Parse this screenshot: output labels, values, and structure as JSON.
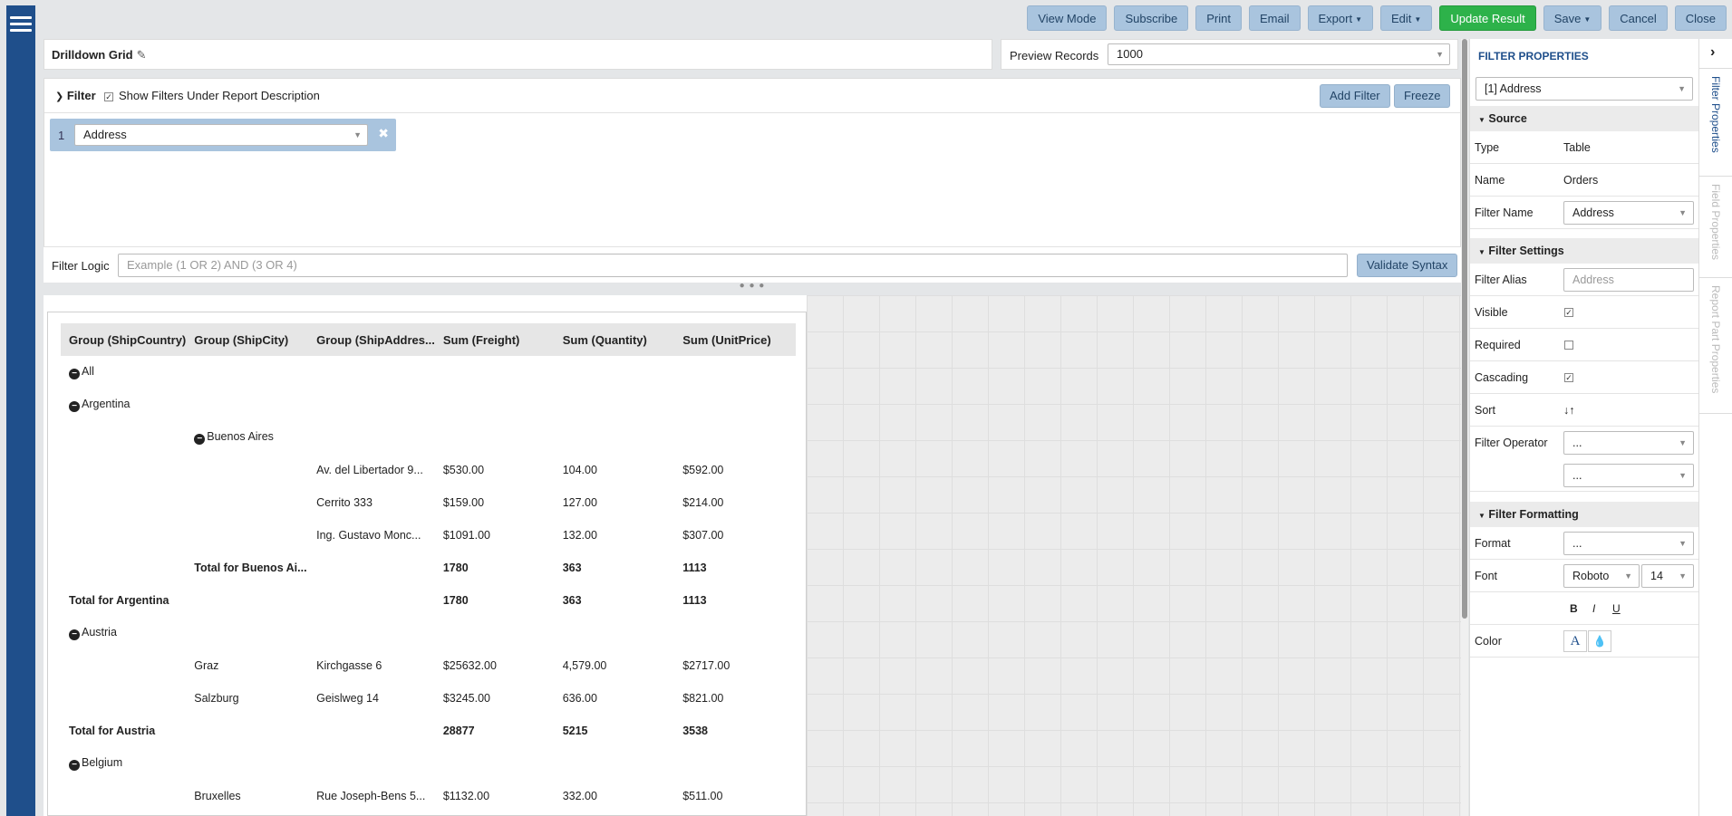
{
  "toolbar": {
    "view_mode": "View Mode",
    "subscribe": "Subscribe",
    "print": "Print",
    "email": "Email",
    "export": "Export",
    "edit": "Edit",
    "update_result": "Update Result",
    "save": "Save",
    "cancel": "Cancel",
    "close": "Close"
  },
  "report": {
    "title": "Drilldown Grid",
    "preview_label": "Preview Records",
    "preview_value": "1000"
  },
  "filter": {
    "title": "Filter",
    "show_under_desc": "Show Filters Under Report Description",
    "add_filter": "Add Filter",
    "freeze": "Freeze",
    "row_number": "1",
    "row_field": "Address",
    "logic_label": "Filter Logic",
    "logic_placeholder": "Example (1 OR 2) AND (3 OR 4)",
    "validate": "Validate Syntax"
  },
  "grid": {
    "headers": [
      "Group (ShipCountry)",
      "Group (ShipCity)",
      "Group (ShipAddres...",
      "Sum (Freight)",
      "Sum (Quantity)",
      "Sum (UnitPrice)"
    ],
    "rows": [
      {
        "c0": "All"
      },
      {
        "c0": "Argentina"
      },
      {
        "c1": "Buenos Aires"
      },
      {
        "c2": "Av. del Libertador 9...",
        "c3": "$530.00",
        "c4": "104.00",
        "c5": "$592.00"
      },
      {
        "c2": "Cerrito 333",
        "c3": "$159.00",
        "c4": "127.00",
        "c5": "$214.00"
      },
      {
        "c2": "Ing. Gustavo Monc...",
        "c3": "$1091.00",
        "c4": "132.00",
        "c5": "$307.00"
      },
      {
        "c1": "Total for Buenos Ai...",
        "c3": "1780",
        "c4": "363",
        "c5": "1113"
      },
      {
        "c0": "Total for Argentina",
        "c3": "1780",
        "c4": "363",
        "c5": "1113"
      },
      {
        "c0": "Austria"
      },
      {
        "c1": "Graz",
        "c2": "Kirchgasse 6",
        "c3": "$25632.00",
        "c4": "4,579.00",
        "c5": "$2717.00"
      },
      {
        "c1": "Salzburg",
        "c2": "Geislweg 14",
        "c3": "$3245.00",
        "c4": "636.00",
        "c5": "$821.00"
      },
      {
        "c0": "Total for Austria",
        "c3": "28877",
        "c4": "5215",
        "c5": "3538"
      },
      {
        "c0": "Belgium"
      },
      {
        "c1": "Bruxelles",
        "c2": "Rue Joseph-Bens 5...",
        "c3": "$1132.00",
        "c4": "332.00",
        "c5": "$511.00"
      }
    ]
  },
  "props": {
    "header": "FILTER PROPERTIES",
    "selected_filter": "[1] Address",
    "source_section": "Source",
    "type_label": "Type",
    "type_value": "Table",
    "name_label": "Name",
    "name_value": "Orders",
    "filter_name_label": "Filter Name",
    "filter_name_value": "Address",
    "settings_section": "Filter Settings",
    "alias_label": "Filter Alias",
    "alias_placeholder": "Address",
    "visible_label": "Visible",
    "required_label": "Required",
    "cascading_label": "Cascading",
    "sort_label": "Sort",
    "operator_label": "Filter Operator",
    "operator_value_1": "...",
    "operator_value_2": "...",
    "formatting_section": "Filter Formatting",
    "format_label": "Format",
    "format_value": "...",
    "font_label": "Font",
    "font_family": "Roboto",
    "font_size": "14",
    "bold": "B",
    "italic": "I",
    "underline": "U",
    "color_label": "Color",
    "color_glyph": "A"
  },
  "vtabs": {
    "filter_props": "Filter Properties",
    "field_props": "Field Properties",
    "report_part_props": "Report Part Properties"
  },
  "colors": {
    "accent_blue": "#1f4f8b",
    "button_blue": "#a9c4de",
    "update_green": "#2db24a"
  }
}
